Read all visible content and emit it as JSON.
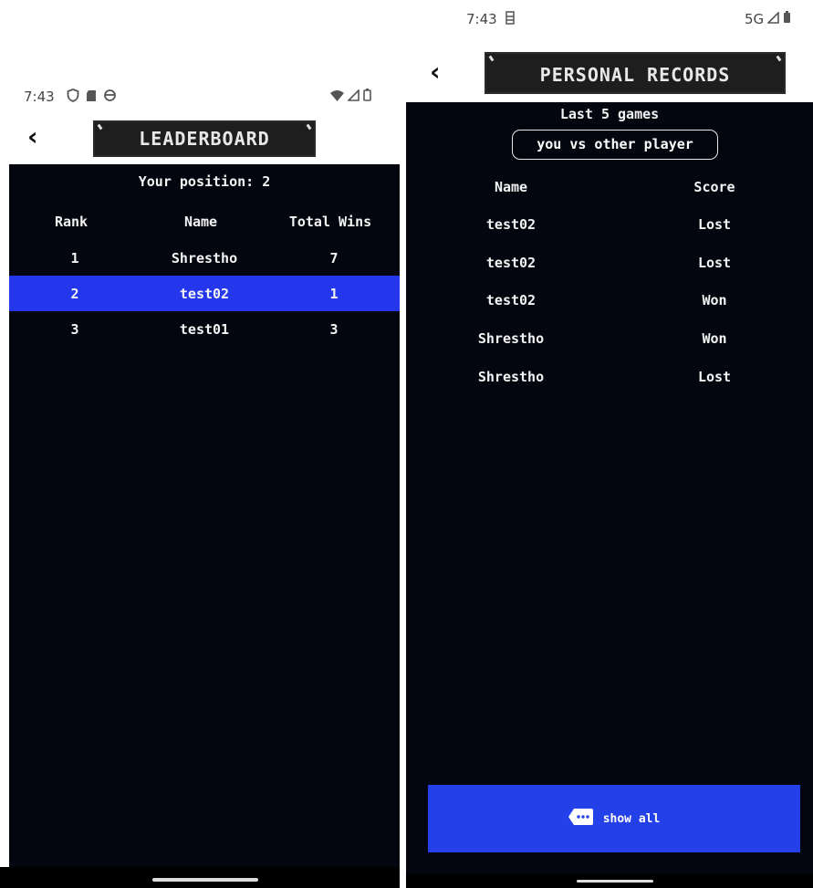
{
  "left": {
    "status": {
      "time": "7:43"
    },
    "title": "LEADERBOARD",
    "position_text": "Your position: 2",
    "columns": [
      "Rank",
      "Name",
      "Total Wins"
    ],
    "rows": [
      {
        "rank": "1",
        "name": "Shrestho",
        "wins": "7",
        "highlighted": false
      },
      {
        "rank": "2",
        "name": "test02",
        "wins": "1",
        "highlighted": true
      },
      {
        "rank": "3",
        "name": "test01",
        "wins": "3",
        "highlighted": false
      }
    ]
  },
  "right": {
    "status": {
      "time": "7:43",
      "network": "5G"
    },
    "title": "PERSONAL RECORDS",
    "subtitle": "Last 5 games",
    "toggle_label": "you vs other player",
    "columns": [
      "Name",
      "Score"
    ],
    "rows": [
      {
        "name": "test02",
        "score": "Lost"
      },
      {
        "name": "test02",
        "score": "Lost"
      },
      {
        "name": "test02",
        "score": "Won"
      },
      {
        "name": "Shrestho",
        "score": "Won"
      },
      {
        "name": "Shrestho",
        "score": "Lost"
      }
    ],
    "show_all_label": "show all"
  },
  "colors": {
    "background": "#04060f",
    "accent": "#2437ec",
    "text": "#f4f4f4"
  },
  "icons": [
    "back-arrow-icon",
    "shield-icon",
    "sd-card-icon",
    "sync-icon",
    "wifi-icon",
    "signal-icon",
    "battery-icon",
    "chat-bubble-icon"
  ]
}
